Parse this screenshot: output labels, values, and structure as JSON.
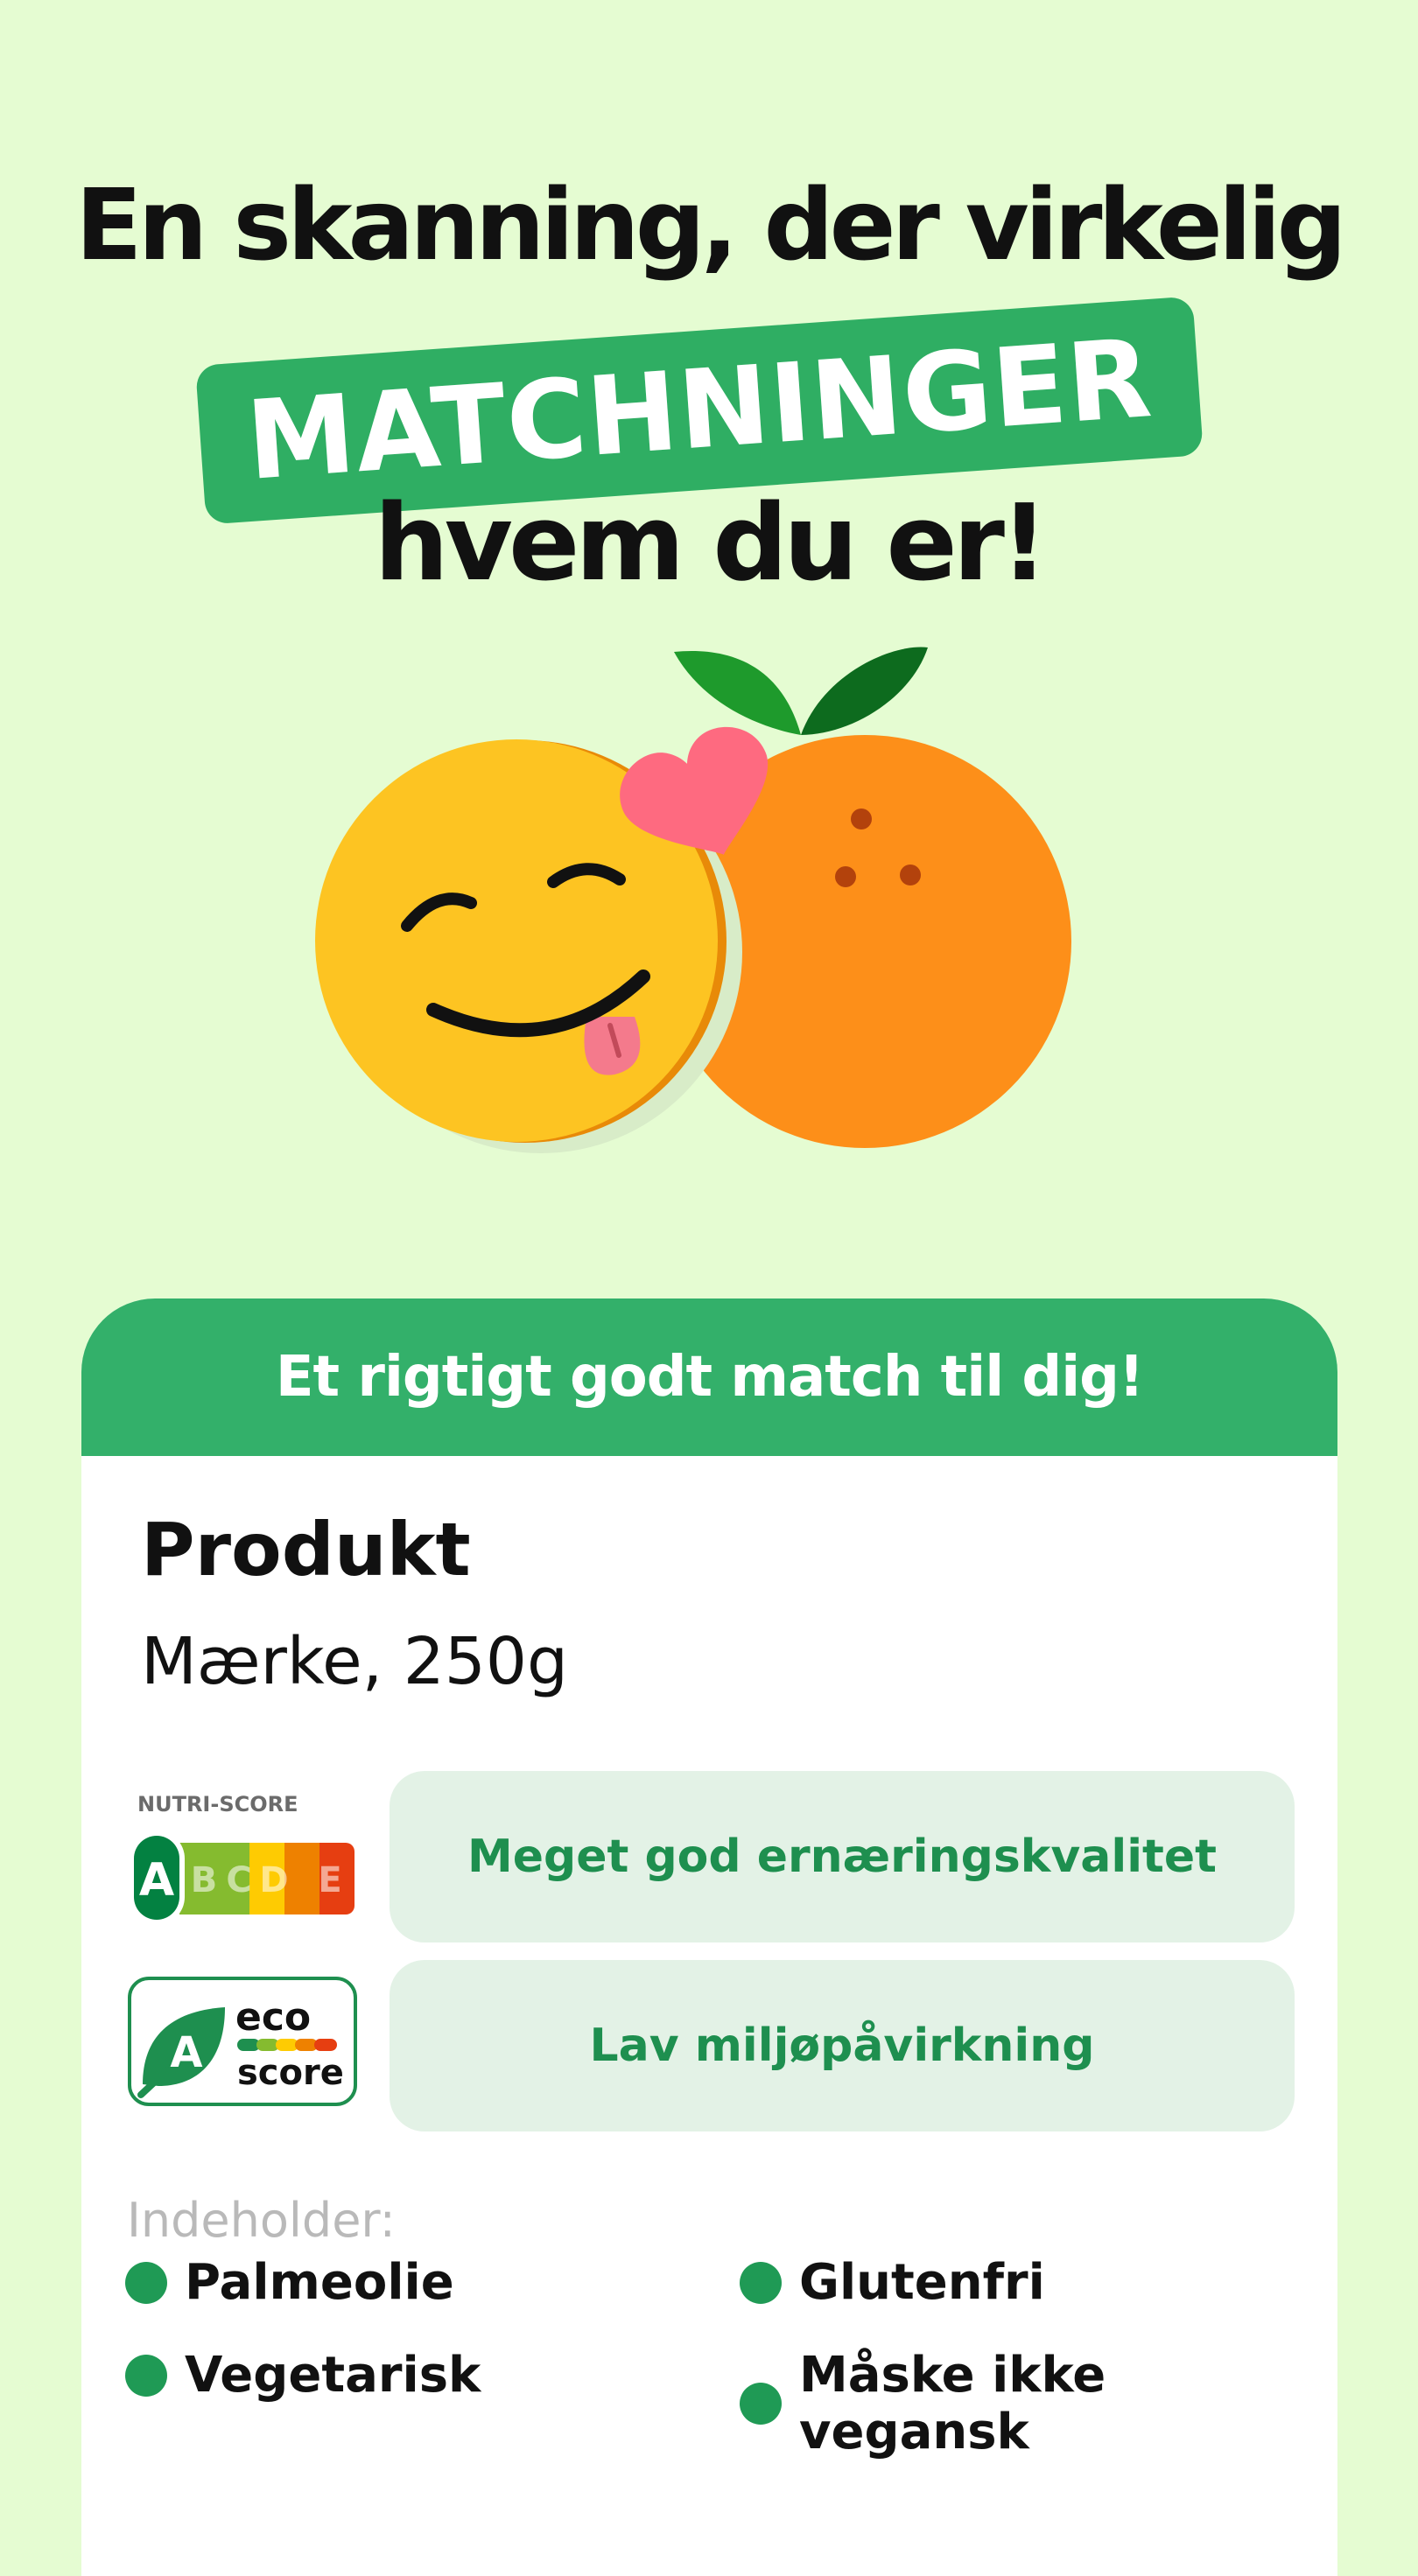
{
  "headline": {
    "line1": "En skanning, der virkelig",
    "highlight": "MATCHNINGER",
    "line3": "hvem du er!"
  },
  "card": {
    "header": "Et rigtigt godt match til dig!",
    "product_name": "Produkt",
    "product_subtitle": "Mærke, 250g",
    "nutri_score": {
      "label": "NUTRI-SCORE",
      "grades": [
        "A",
        "B",
        "C",
        "D",
        "E"
      ],
      "selected": "A",
      "description": "Meget god ernæringskvalitet"
    },
    "eco_score": {
      "grade": "A",
      "word1": "eco",
      "word2": "score",
      "description": "Lav miljøpåvirkning"
    },
    "contains_label": "Indeholder:",
    "tags": [
      "Palmeolie",
      "Glutenfri",
      "Vegetarisk",
      "Måske ikke vegansk"
    ]
  },
  "colors": {
    "background": "#e5fcd2",
    "brand_green": "#2fae63",
    "pill_bg": "#e3f2e6",
    "pill_text": "#1e8f4f",
    "dot": "#1f9a55"
  },
  "icons": [
    "smiley-face-icon",
    "heart-icon",
    "orange-fruit-icon",
    "leaf-icon"
  ]
}
